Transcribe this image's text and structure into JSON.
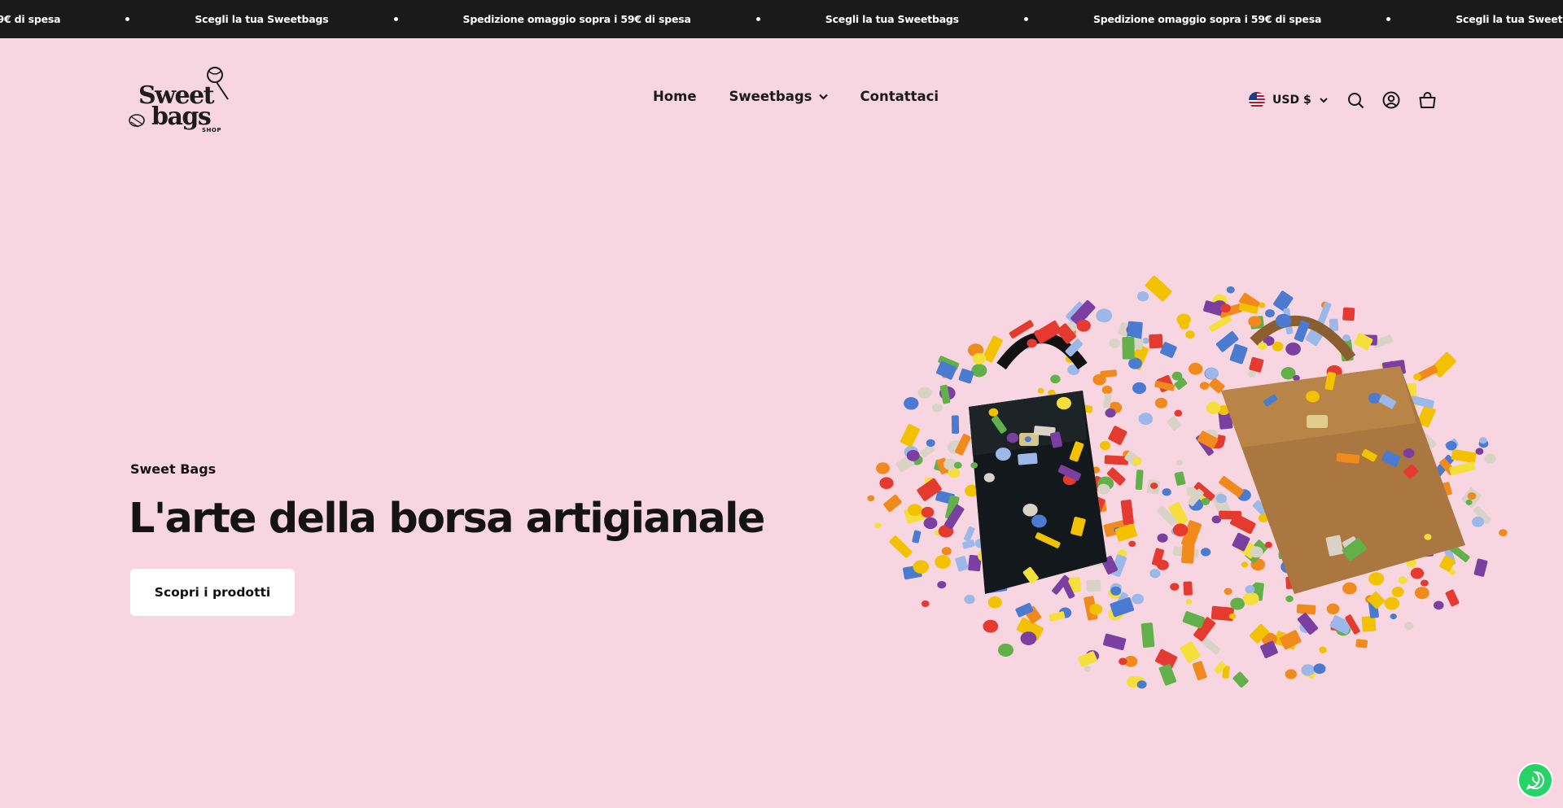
{
  "announcement": {
    "messages": [
      "59€ di spesa",
      "Scegli la tua Sweetbags",
      "Spedizione omaggio sopra i 59€ di spesa",
      "Scegli la tua Sweetbags",
      "Spedizione omaggio sopra i 59€ di spesa",
      "Scegli la tua Sweetbags"
    ]
  },
  "header": {
    "logo": {
      "line1": "Sweet",
      "line2": "bags",
      "line3": "SHOP"
    },
    "nav": [
      {
        "label": "Home"
      },
      {
        "label": "Sweetbags"
      },
      {
        "label": "Contattaci"
      }
    ],
    "currency": "USD $"
  },
  "hero": {
    "subheading": "Sweet Bags",
    "title": "L'arte della borsa artigianale",
    "cta_label": "Scopri i prodotti"
  },
  "colors": {
    "page_background": "#f7d6e2",
    "announcement_bar": "#1a1a1a",
    "text": "#141414",
    "whatsapp": "#25d366"
  },
  "icons": [
    "chevron-down-icon",
    "us-flag-icon",
    "search-icon",
    "account-icon",
    "cart-icon",
    "whatsapp-icon"
  ]
}
